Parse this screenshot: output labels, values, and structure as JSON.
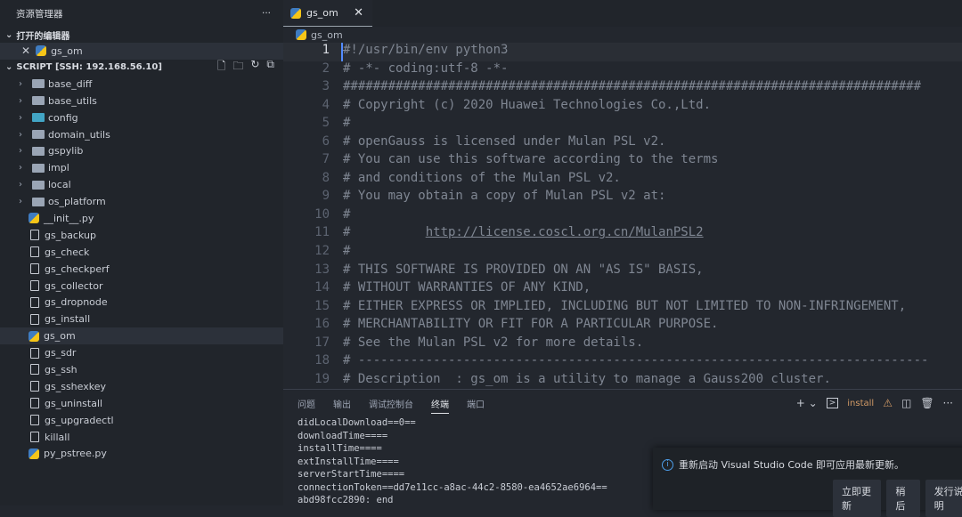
{
  "sidebar": {
    "title": "资源管理器",
    "more": "···",
    "open_editors": "打开的编辑器",
    "open_file": "gs_om",
    "workspace": "SCRIPT [SSH: 192.168.56.10]",
    "folders": [
      {
        "name": "base_diff"
      },
      {
        "name": "base_utils"
      },
      {
        "name": "config"
      },
      {
        "name": "domain_utils"
      },
      {
        "name": "gspylib"
      },
      {
        "name": "impl"
      },
      {
        "name": "local"
      },
      {
        "name": "os_platform"
      }
    ],
    "files": [
      {
        "name": "__init__.py",
        "py": true
      },
      {
        "name": "gs_backup"
      },
      {
        "name": "gs_check"
      },
      {
        "name": "gs_checkperf"
      },
      {
        "name": "gs_collector"
      },
      {
        "name": "gs_dropnode"
      },
      {
        "name": "gs_install"
      },
      {
        "name": "gs_om",
        "py": true,
        "selected": true
      },
      {
        "name": "gs_sdr"
      },
      {
        "name": "gs_ssh"
      },
      {
        "name": "gs_sshexkey"
      },
      {
        "name": "gs_uninstall"
      },
      {
        "name": "gs_upgradectl"
      },
      {
        "name": "killall"
      },
      {
        "name": "py_pstree.py",
        "py": true
      }
    ]
  },
  "editor": {
    "tab": "gs_om",
    "breadcrumb": "gs_om",
    "lines": [
      "#!/usr/bin/env python3",
      "# -*- coding:utf-8 -*-",
      "#############################################################################",
      "# Copyright (c) 2020 Huawei Technologies Co.,Ltd.",
      "#",
      "# openGauss is licensed under Mulan PSL v2.",
      "# You can use this software according to the terms",
      "# and conditions of the Mulan PSL v2.",
      "# You may obtain a copy of Mulan PSL v2 at:",
      "#",
      "#          http://license.coscl.org.cn/MulanPSL2",
      "#",
      "# THIS SOFTWARE IS PROVIDED ON AN \"AS IS\" BASIS,",
      "# WITHOUT WARRANTIES OF ANY KIND,",
      "# EITHER EXPRESS OR IMPLIED, INCLUDING BUT NOT LIMITED TO NON-INFRINGEMENT,",
      "# MERCHANTABILITY OR FIT FOR A PARTICULAR PURPOSE.",
      "# See the Mulan PSL v2 for more details.",
      "# ----------------------------------------------------------------------------",
      "# Description  : gs_om is a utility to manage a Gauss200 cluster."
    ]
  },
  "panel": {
    "tabs": [
      "问题",
      "输出",
      "调试控制台",
      "终端",
      "端口"
    ],
    "active": 3,
    "terminal_name": "install",
    "terminal": [
      "didLocalDownload==0==",
      "downloadTime====",
      "installTime====",
      "extInstallTime====",
      "serverStartTime====",
      "connectionToken==dd7e11cc-a8ac-44c2-8580-ea4652ae6964==",
      "abd98fcc2890: end"
    ]
  },
  "toast": {
    "message": "重新启动 Visual Studio Code 即可应用最新更新。",
    "buttons": [
      "立即更新",
      "稍后",
      "发行说明"
    ]
  }
}
